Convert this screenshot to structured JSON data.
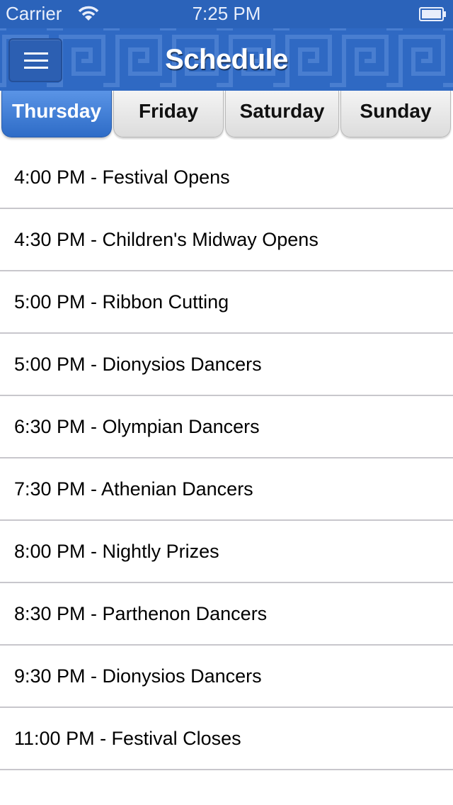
{
  "status_bar": {
    "carrier": "Carrier",
    "time": "7:25 PM"
  },
  "nav": {
    "title": "Schedule",
    "menu_icon": "hamburger-menu-icon",
    "bar_color": "#2f69c3"
  },
  "tabs": [
    {
      "label": "Thursday",
      "active": true
    },
    {
      "label": "Friday",
      "active": false
    },
    {
      "label": "Saturday",
      "active": false
    },
    {
      "label": "Sunday",
      "active": false
    }
  ],
  "schedule": [
    "4:00 PM - Festival Opens",
    "4:30 PM - Children's Midway Opens",
    "5:00 PM - Ribbon Cutting",
    "5:00 PM - Dionysios Dancers",
    "6:30 PM - Olympian Dancers",
    "7:30 PM - Athenian Dancers",
    "8:00 PM - Nightly Prizes",
    "8:30 PM - Parthenon Dancers",
    "9:30 PM - Dionysios Dancers",
    "11:00 PM - Festival Closes"
  ],
  "colors": {
    "accent": "#2f69c3",
    "active_tab": "#3d7bd6",
    "separator": "#c8c7cc"
  }
}
